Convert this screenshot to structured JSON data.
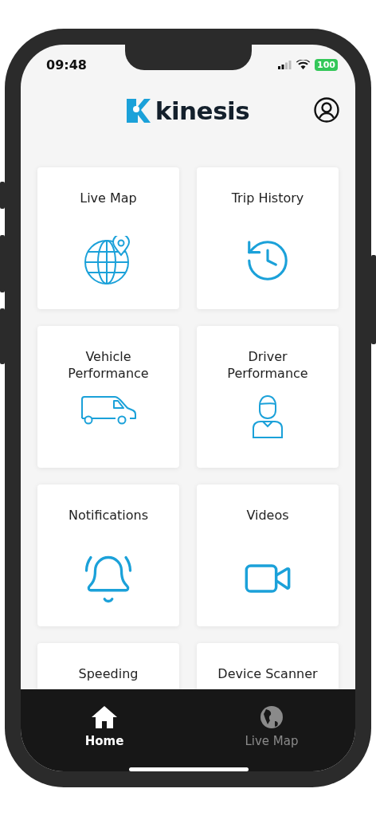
{
  "status_bar": {
    "time": "09:48",
    "battery": "100"
  },
  "header": {
    "brand": "kinesis"
  },
  "tiles": [
    {
      "label": "Live Map",
      "kind": "globe"
    },
    {
      "label": "Trip History",
      "kind": "history"
    },
    {
      "label": "Vehicle Performance",
      "kind": "van"
    },
    {
      "label": "Driver Performance",
      "kind": "driver"
    },
    {
      "label": "Notifications",
      "kind": "bell"
    },
    {
      "label": "Videos",
      "kind": "video"
    },
    {
      "label": "Speeding",
      "kind": "none"
    },
    {
      "label": "Device Scanner",
      "kind": "none"
    }
  ],
  "tab_bar": [
    {
      "label": "Home",
      "kind": "home",
      "selected": true
    },
    {
      "label": "Live Map",
      "kind": "globe",
      "selected": false
    }
  ]
}
